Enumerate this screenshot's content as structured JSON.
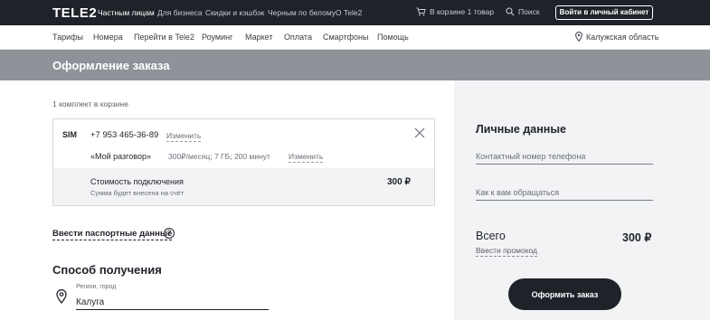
{
  "header": {
    "logo": "TELE2",
    "nav": [
      "Частным лицам",
      "Для бизнеса",
      "Скидки и кэшбэк",
      "Черным по белому",
      "О Tele2"
    ],
    "cart_text": "В корзине 1 товар",
    "search_label": "Поиск",
    "login_label": "Войти в личный кабинет"
  },
  "subnav": {
    "items": [
      "Тарифы",
      "Номера",
      "Перейти в Tele2",
      "Роуминг",
      "Маркет",
      "Оплата",
      "Смартфоны",
      "Помощь"
    ],
    "region": "Калужская область"
  },
  "page": {
    "title": "Оформление заказа"
  },
  "cart": {
    "count_text": "1 комплект в корзине",
    "sim_label": "SIM",
    "phone": "+7 953 465-36-89",
    "change_label": "Изменить",
    "tariff_name": "«Мой разговор»",
    "tariff_desc": "300₽/месяц; 7 ГБ; 200 минут",
    "tariff_change_label": "Изменить",
    "fee_label": "Стоимость подключения",
    "fee_note": "Сумма будет внесена на счёт",
    "fee_price": "300 ₽"
  },
  "passport": {
    "label": "Ввести паспортные данные",
    "help": "?"
  },
  "delivery": {
    "title": "Способ получения",
    "region_label": "Регион, город",
    "city_value": "Калуга"
  },
  "personal": {
    "title": "Личные данные",
    "phone_placeholder": "Контактный номер телефона",
    "name_placeholder": "Как к вам обращаться"
  },
  "summary": {
    "total_label": "Всего",
    "total_price": "300 ₽",
    "promo_label": "Ввести промокод",
    "order_button": "Оформить заказ"
  },
  "colors": {
    "dark": "#1f2229",
    "title_bar": "#8f9399",
    "panel": "#f2f3f5"
  }
}
